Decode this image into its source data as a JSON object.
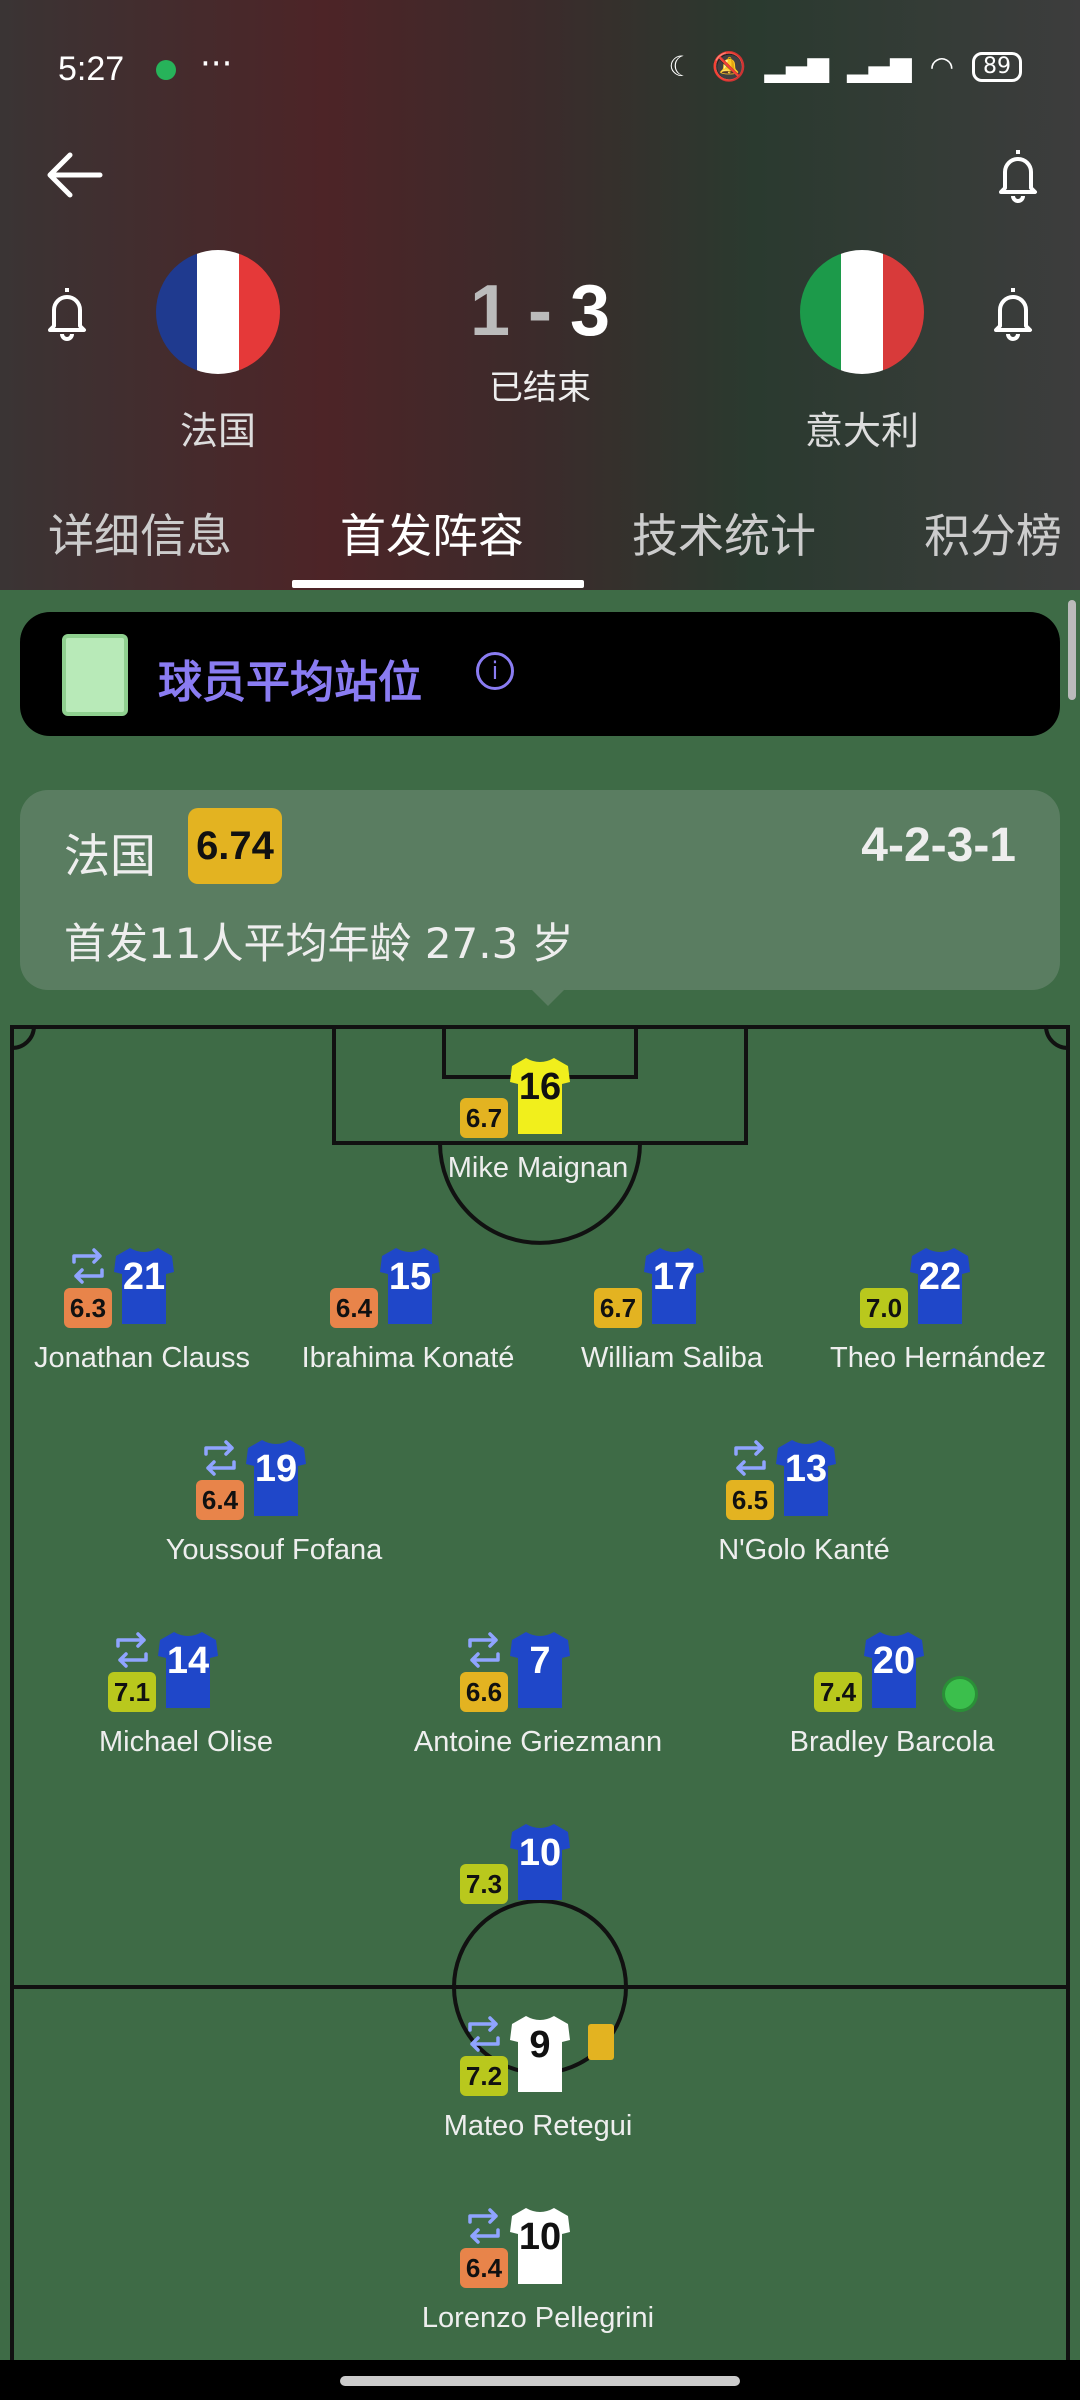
{
  "status_bar": {
    "time": "5:27",
    "more": "···",
    "battery": "89"
  },
  "match": {
    "home_team": "法国",
    "away_team": "意大利",
    "home_score": "1",
    "away_score": "3",
    "separator": "-",
    "status": "已结束",
    "home_flag_colors": [
      "#1f3a8f",
      "#ffffff",
      "#e53939"
    ],
    "away_flag_colors": [
      "#1c9a4a",
      "#ffffff",
      "#d83a3a"
    ]
  },
  "tabs": [
    {
      "label": "详细信息"
    },
    {
      "label": "首发阵容"
    },
    {
      "label": "技术统计"
    },
    {
      "label": "积分榜"
    }
  ],
  "avg_position": {
    "label": "球员平均站位",
    "info_icon": "info-icon"
  },
  "team_card": {
    "team": "法国",
    "rating": "6.74",
    "formation": "4-2-3-1",
    "age_label": "首发11人平均年龄",
    "age_value": "27.3 岁"
  },
  "players": [
    {
      "name": "Mike Maignan",
      "number": "16",
      "rating": "6.7",
      "kit": "yellow",
      "sub": false
    },
    {
      "name": "Jonathan Clauss",
      "number": "21",
      "rating": "6.3",
      "kit": "blue",
      "sub": true
    },
    {
      "name": "Ibrahima Konaté",
      "number": "15",
      "rating": "6.4",
      "kit": "blue",
      "sub": false
    },
    {
      "name": "William Saliba",
      "number": "17",
      "rating": "6.7",
      "kit": "blue",
      "sub": false
    },
    {
      "name": "Theo Hernández",
      "number": "22",
      "rating": "7.0",
      "kit": "blue",
      "sub": false
    },
    {
      "name": "Youssouf Fofana",
      "number": "19",
      "rating": "6.4",
      "kit": "blue",
      "sub": true
    },
    {
      "name": "N'Golo Kanté",
      "number": "13",
      "rating": "6.5",
      "kit": "blue",
      "sub": true
    },
    {
      "name": "Michael Olise",
      "number": "14",
      "rating": "7.1",
      "kit": "blue",
      "sub": true
    },
    {
      "name": "Antoine Griezmann",
      "number": "7",
      "rating": "6.6",
      "kit": "blue",
      "sub": true
    },
    {
      "name": "Bradley Barcola",
      "number": "20",
      "rating": "7.4",
      "kit": "blue",
      "sub": false
    },
    {
      "name": "",
      "number": "10",
      "rating": "7.3",
      "kit": "blue",
      "sub": false
    },
    {
      "name": "Mateo Retegui",
      "number": "9",
      "rating": "7.2",
      "kit": "white",
      "sub": true
    },
    {
      "name": "Lorenzo Pellegrini",
      "number": "10",
      "rating": "6.4",
      "kit": "white",
      "sub": true
    }
  ],
  "rating_colors": {
    "orange": "#e8844a",
    "yellow": "#e3b321",
    "lime": "#b9c81d"
  }
}
